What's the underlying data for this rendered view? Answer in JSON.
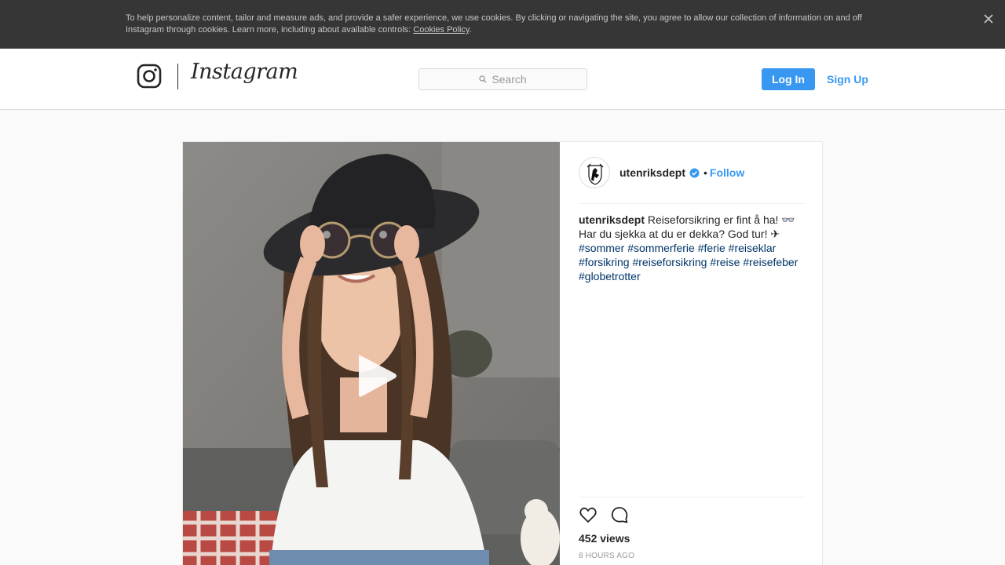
{
  "cookie_banner": {
    "text": "To help personalize content, tailor and measure ads, and provide a safer experience, we use cookies. By clicking or navigating the site, you agree to allow our collection of information on and off Instagram through cookies. Learn more, including about available controls: ",
    "link_label": "Cookies Policy",
    "suffix": ".",
    "close_icon": "close-icon"
  },
  "header": {
    "logo_icon": "instagram-glyph-icon",
    "wordmark": "Instagram",
    "search": {
      "placeholder": "Search",
      "icon": "search-icon"
    },
    "login_label": "Log In",
    "signup_label": "Sign Up",
    "accent_color": "#3897f0"
  },
  "post": {
    "media": {
      "type": "video",
      "play_icon": "play-icon"
    },
    "author": {
      "username": "utenriksdept",
      "verified": true,
      "verified_icon": "verified-badge-icon",
      "separator": "•",
      "follow_label": "Follow"
    },
    "caption": {
      "username": "utenriksdept",
      "text": "Reiseforsikring er fint å ha! 👓 Har du sjekka at du er dekka? God tur! ✈",
      "hashtags": [
        "#sommer",
        "#sommerferie",
        "#ferie",
        "#reiseklar",
        "#forsikring",
        "#reiseforsikring",
        "#reise",
        "#reisefeber",
        "#globetrotter"
      ]
    },
    "actions": {
      "like_icon": "heart-icon",
      "comment_icon": "comment-icon"
    },
    "views": "452 views",
    "time": "8 HOURS AGO"
  }
}
